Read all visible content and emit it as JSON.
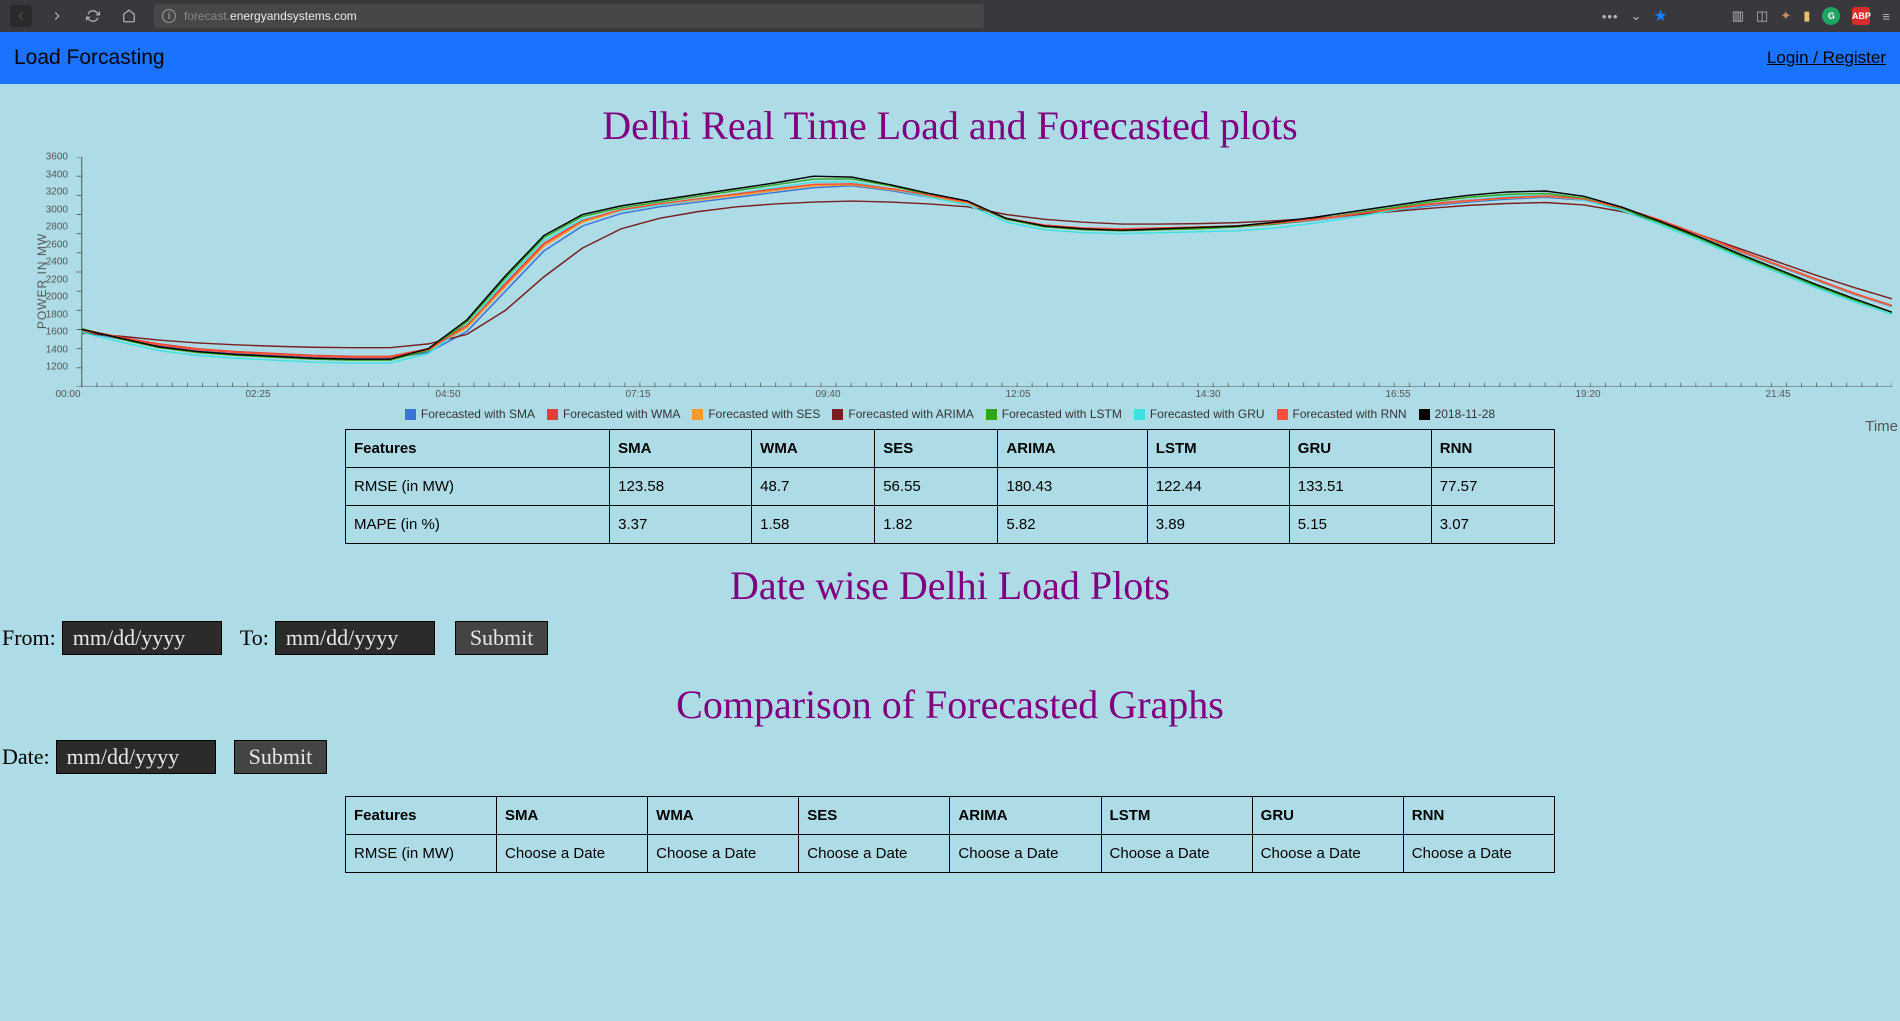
{
  "browser": {
    "url_display": "forecast.energyandsystems.com",
    "url_host_bold": "energyandsystems.com"
  },
  "topbar": {
    "brand": "Load Forcasting",
    "login": "Login / Register"
  },
  "headings": {
    "main": "Delhi Real Time Load and Forecasted plots",
    "datewise": "Date wise Delhi Load Plots",
    "compare": "Comparison of Forecasted Graphs"
  },
  "chart_data": {
    "type": "line",
    "title": "Delhi Real Time Load and Forecasted plots",
    "xlabel": "Time",
    "ylabel": "POWER IN MW",
    "ylim": [
      1200,
      3600
    ],
    "yticks": [
      1200,
      1400,
      1600,
      1800,
      2000,
      2200,
      2400,
      2600,
      2800,
      3000,
      3200,
      3400,
      3600
    ],
    "xticks": [
      "00:00",
      "02:25",
      "04:50",
      "07:15",
      "09:40",
      "12:05",
      "14:30",
      "16:55",
      "19:20",
      "21:45"
    ],
    "legend": [
      {
        "name": "Forecasted with SMA",
        "color": "#3a74d8"
      },
      {
        "name": "Forecasted with WMA",
        "color": "#e23f38"
      },
      {
        "name": "Forecasted with SES",
        "color": "#f39c2c"
      },
      {
        "name": "Forecasted with ARIMA",
        "color": "#7a1f1f"
      },
      {
        "name": "Forecasted with LSTM",
        "color": "#2fa71b"
      },
      {
        "name": "Forecasted with GRU",
        "color": "#3fe0e0"
      },
      {
        "name": "Forecasted with RNN",
        "color": "#ff4e3a"
      },
      {
        "name": "2018-11-28",
        "color": "#000000"
      }
    ],
    "series_comment": "Values sampled at roughly 30-min resolution across 24h; estimated from plot gridlines.",
    "x": [
      "00:00",
      "00:30",
      "01:00",
      "01:30",
      "02:00",
      "02:30",
      "03:00",
      "03:30",
      "04:00",
      "04:30",
      "05:00",
      "05:30",
      "06:00",
      "06:30",
      "07:00",
      "07:30",
      "08:00",
      "08:30",
      "09:00",
      "09:30",
      "10:00",
      "10:30",
      "11:00",
      "11:30",
      "12:00",
      "12:30",
      "13:00",
      "13:30",
      "14:00",
      "14:30",
      "15:00",
      "15:30",
      "16:00",
      "16:30",
      "17:00",
      "17:30",
      "18:00",
      "18:30",
      "19:00",
      "19:30",
      "20:00",
      "20:30",
      "21:00",
      "21:30",
      "22:00",
      "22:30",
      "23:00",
      "23:30"
    ],
    "series": [
      {
        "name": "Forecasted with SMA",
        "color": "#3a74d8",
        "values": [
          1780,
          1700,
          1630,
          1580,
          1550,
          1530,
          1510,
          1500,
          1500,
          1560,
          1780,
          2200,
          2620,
          2880,
          3010,
          3080,
          3130,
          3180,
          3230,
          3280,
          3300,
          3250,
          3180,
          3120,
          2950,
          2880,
          2850,
          2840,
          2850,
          2860,
          2870,
          2900,
          2940,
          2990,
          3040,
          3090,
          3130,
          3160,
          3180,
          3150,
          3060,
          2930,
          2780,
          2620,
          2470,
          2320,
          2170,
          2040
        ]
      },
      {
        "name": "Forecasted with WMA",
        "color": "#e23f38",
        "values": [
          1800,
          1720,
          1650,
          1600,
          1570,
          1550,
          1530,
          1520,
          1520,
          1600,
          1850,
          2280,
          2700,
          2940,
          3050,
          3110,
          3160,
          3210,
          3260,
          3310,
          3320,
          3270,
          3200,
          3130,
          2960,
          2890,
          2860,
          2850,
          2860,
          2870,
          2880,
          2910,
          2950,
          3000,
          3060,
          3110,
          3150,
          3180,
          3200,
          3160,
          3070,
          2940,
          2790,
          2630,
          2480,
          2330,
          2180,
          2050
        ]
      },
      {
        "name": "Forecasted with SES",
        "color": "#f39c2c",
        "values": [
          1790,
          1710,
          1640,
          1590,
          1560,
          1540,
          1520,
          1510,
          1510,
          1580,
          1820,
          2250,
          2670,
          2920,
          3040,
          3100,
          3150,
          3200,
          3250,
          3300,
          3310,
          3260,
          3190,
          3120,
          2955,
          2885,
          2855,
          2845,
          2855,
          2865,
          2875,
          2905,
          2945,
          2995,
          3050,
          3100,
          3140,
          3170,
          3190,
          3155,
          3065,
          2935,
          2785,
          2625,
          2475,
          2325,
          2175,
          2045
        ]
      },
      {
        "name": "Forecasted with ARIMA",
        "color": "#7a1f1f",
        "values": [
          1760,
          1730,
          1690,
          1660,
          1640,
          1625,
          1615,
          1610,
          1610,
          1650,
          1750,
          2000,
          2350,
          2650,
          2850,
          2960,
          3030,
          3080,
          3110,
          3130,
          3140,
          3130,
          3110,
          3080,
          3000,
          2950,
          2920,
          2900,
          2900,
          2905,
          2915,
          2935,
          2960,
          2995,
          3030,
          3065,
          3095,
          3115,
          3125,
          3100,
          3030,
          2920,
          2790,
          2650,
          2510,
          2370,
          2240,
          2120
        ]
      },
      {
        "name": "Forecasted with LSTM",
        "color": "#2fa71b",
        "values": [
          1810,
          1700,
          1610,
          1560,
          1530,
          1510,
          1490,
          1480,
          1480,
          1580,
          1880,
          2340,
          2760,
          2980,
          3070,
          3130,
          3190,
          3250,
          3310,
          3370,
          3370,
          3300,
          3210,
          3130,
          2950,
          2870,
          2840,
          2830,
          2840,
          2850,
          2870,
          2900,
          2950,
          3010,
          3070,
          3130,
          3180,
          3210,
          3220,
          3170,
          3060,
          2910,
          2750,
          2580,
          2420,
          2260,
          2110,
          1980
        ]
      },
      {
        "name": "Forecasted with GRU",
        "color": "#3fe0e0",
        "values": [
          1770,
          1670,
          1580,
          1530,
          1500,
          1480,
          1460,
          1450,
          1450,
          1550,
          1850,
          2310,
          2730,
          2950,
          3040,
          3100,
          3160,
          3220,
          3280,
          3340,
          3340,
          3270,
          3180,
          3100,
          2920,
          2840,
          2810,
          2800,
          2810,
          2820,
          2830,
          2860,
          2910,
          2970,
          3040,
          3100,
          3150,
          3190,
          3200,
          3150,
          3040,
          2890,
          2730,
          2560,
          2400,
          2240,
          2090,
          1960
        ]
      },
      {
        "name": "Forecasted with RNN",
        "color": "#ff4e3a",
        "values": [
          1800,
          1720,
          1640,
          1590,
          1560,
          1540,
          1520,
          1510,
          1510,
          1590,
          1840,
          2270,
          2690,
          2935,
          3050,
          3110,
          3165,
          3215,
          3265,
          3315,
          3320,
          3270,
          3200,
          3130,
          2960,
          2890,
          2860,
          2850,
          2860,
          2870,
          2880,
          2910,
          2950,
          3000,
          3055,
          3105,
          3145,
          3175,
          3195,
          3160,
          3070,
          2940,
          2790,
          2630,
          2480,
          2330,
          2180,
          2050
        ]
      },
      {
        "name": "2018-11-28",
        "color": "#000000",
        "values": [
          1800,
          1710,
          1620,
          1570,
          1540,
          1520,
          1500,
          1490,
          1490,
          1600,
          1900,
          2360,
          2780,
          3000,
          3090,
          3150,
          3210,
          3270,
          3330,
          3400,
          3390,
          3310,
          3220,
          3140,
          2960,
          2880,
          2850,
          2835,
          2850,
          2865,
          2880,
          2920,
          2970,
          3030,
          3090,
          3150,
          3200,
          3235,
          3245,
          3190,
          3075,
          2925,
          2765,
          2595,
          2435,
          2275,
          2125,
          1980
        ]
      }
    ]
  },
  "tables": {
    "metrics": {
      "headers": [
        "Features",
        "SMA",
        "WMA",
        "SES",
        "ARIMA",
        "LSTM",
        "GRU",
        "RNN"
      ],
      "rows": [
        [
          "RMSE (in MW)",
          "123.58",
          "48.7",
          "56.55",
          "180.43",
          "122.44",
          "133.51",
          "77.57"
        ],
        [
          "MAPE (in %)",
          "3.37",
          "1.58",
          "1.82",
          "5.82",
          "3.89",
          "5.15",
          "3.07"
        ]
      ]
    },
    "compare": {
      "headers": [
        "Features",
        "SMA",
        "WMA",
        "SES",
        "ARIMA",
        "LSTM",
        "GRU",
        "RNN"
      ],
      "rows": [
        [
          "RMSE (in MW)",
          "Choose a Date",
          "Choose a Date",
          "Choose a Date",
          "Choose a Date",
          "Choose a Date",
          "Choose a Date",
          "Choose a Date"
        ]
      ]
    }
  },
  "forms": {
    "from_label": "From:",
    "to_label": "To:",
    "date_label": "Date:",
    "placeholder": "mm/dd/yyyy",
    "submit": "Submit"
  }
}
